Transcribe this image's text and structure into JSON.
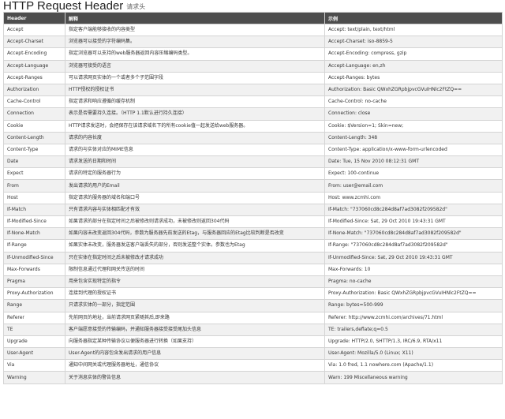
{
  "page": {
    "title": "HTTP Request Header",
    "subtitle": "请求头"
  },
  "table": {
    "headers": [
      "Header",
      "解释",
      "示例"
    ],
    "rows": [
      [
        "Accept",
        "指定客户端能够接收的内容类型",
        "Accept: text/plain, text/html"
      ],
      [
        "Accept-Charset",
        "浏览器可以接受的字符编码集。",
        "Accept-Charset: iso-8859-5"
      ],
      [
        "Accept-Encoding",
        "指定浏览器可以支持的web服务器返回内容压缩编码类型。",
        "Accept-Encoding: compress, gzip"
      ],
      [
        "Accept-Language",
        "浏览器可接受的语言",
        "Accept-Language: en,zh"
      ],
      [
        "Accept-Ranges",
        "可以请求网页实体的一个或者多个子范围字段",
        "Accept-Ranges: bytes"
      ],
      [
        "Authorization",
        "HTTP授权的授权证书",
        "Authorization: Basic QWxhZGRpbjpvcGVuIHNlc2FtZQ=="
      ],
      [
        "Cache-Control",
        "指定请求和响应遵循的缓存机制",
        "Cache-Control: no-cache"
      ],
      [
        "Connection",
        "表示是否需要持久连接。（HTTP 1.1默认进行持久连接）",
        "Connection: close"
      ],
      [
        "Cookie",
        "HTTP请求发送时，会把保存在该请求域名下的所有cookie值一起发送给web服务器。",
        "Cookie: $Version=1; Skin=new;"
      ],
      [
        "Content-Length",
        "请求的内容长度",
        "Content-Length: 348"
      ],
      [
        "Content-Type",
        "请求的与实体对应的MIME信息",
        "Content-Type: application/x-www-form-urlencoded"
      ],
      [
        "Date",
        "请求发送的日期和时间",
        "Date: Tue, 15 Nov 2010 08:12:31 GMT"
      ],
      [
        "Expect",
        "请求的特定的服务器行为",
        "Expect: 100-continue"
      ],
      [
        "From",
        "发出请求的用户的Email",
        "From: user@email.com"
      ],
      [
        "Host",
        "指定请求的服务器的域名和端口号",
        "Host: www.zcmhi.com"
      ],
      [
        "If-Match",
        "只有请求内容与实体相匹配才有效",
        "If-Match: \"737060cd8c284d8af7ad3082f209582d\""
      ],
      [
        "If-Modified-Since",
        "如果请求的部分在指定时间之后被修改则请求成功，未被修改则返回304代码",
        "If-Modified-Since: Sat, 29 Oct 2010 19:43:31 GMT"
      ],
      [
        "If-None-Match",
        "如果内容未改变返回304代码，参数为服务器先前发送的Etag，与服务器回应的Etag比较判断是否改变",
        "If-None-Match: \"737060cd8c284d8af7ad3082f209582d\""
      ],
      [
        "If-Range",
        "如果实体未改变，服务器发送客户端丢失的部分，否则发送整个实体。参数也为Etag",
        "If-Range: \"737060cd8c284d8af7ad3082f209582d\""
      ],
      [
        "If-Unmodified-Since",
        "只在实体在指定时间之后未被修改才请求成功",
        "If-Unmodified-Since: Sat, 29 Oct 2010 19:43:31 GMT"
      ],
      [
        "Max-Forwards",
        "限制信息通过代理和网关传送的时间",
        "Max-Forwards: 10"
      ],
      [
        "Pragma",
        "用来包含实现特定的指令",
        "Pragma: no-cache"
      ],
      [
        "Proxy-Authorization",
        "连接到代理的授权证书",
        "Proxy-Authorization: Basic QWxhZGRpbjpvcGVuIHNlc2FtZQ=="
      ],
      [
        "Range",
        "只请求实体的一部分，指定范围",
        "Range: bytes=500-999"
      ],
      [
        "Referer",
        "先前网页的地址，当前请求网页紧随其后,即来路",
        "Referer: http://www.zcmhi.com/archives/71.html"
      ],
      [
        "TE",
        "客户端愿意接受的传输编码，并通知服务器接受接受尾加头信息",
        "TE: trailers,deflate;q=0.5"
      ],
      [
        "Upgrade",
        "向服务器指定某种传输协议以便服务器进行转换（如果支持）",
        "Upgrade: HTTP/2.0, SHTTP/1.3, IRC/6.9, RTA/x11"
      ],
      [
        "User-Agent",
        "User-Agent的内容包含发出请求的用户信息",
        "User-Agent: Mozilla/5.0 (Linux; X11)"
      ],
      [
        "Via",
        "通知中间网关或代理服务器地址，通信协议",
        "Via: 1.0 fred, 1.1 nowhere.com (Apache/1.1)"
      ],
      [
        "Warning",
        "关于消息实体的警告信息",
        "Warn: 199 Miscellaneous warning"
      ]
    ]
  }
}
